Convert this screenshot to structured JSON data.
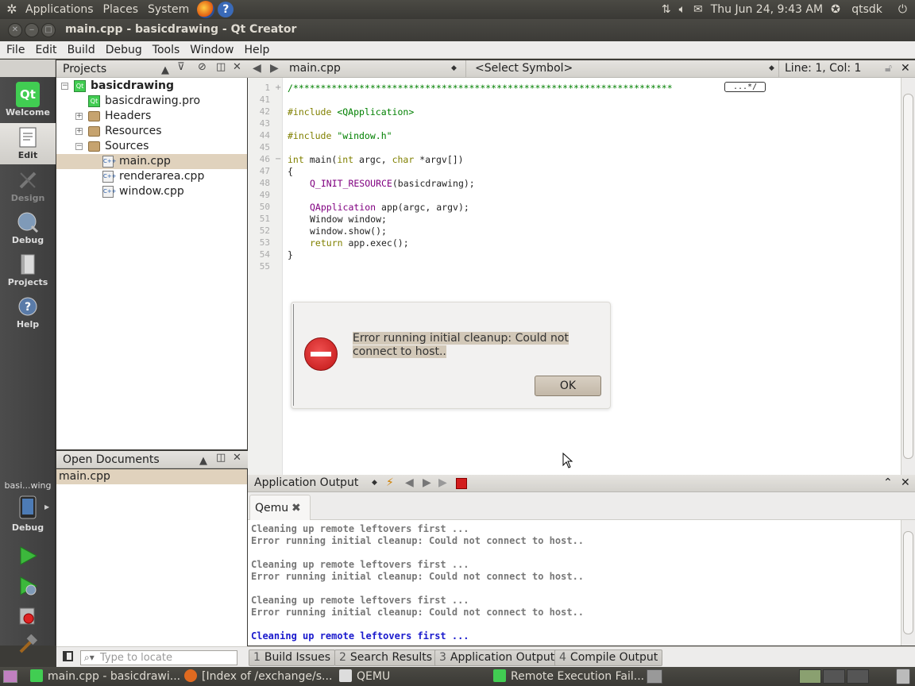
{
  "top_panel": {
    "menus": [
      "Applications",
      "Places",
      "System"
    ],
    "clock": "Thu Jun 24,  9:43 AM",
    "user": "qtsdk"
  },
  "window": {
    "title": "main.cpp - basicdrawing - Qt Creator"
  },
  "menubar": [
    "File",
    "Edit",
    "Build",
    "Debug",
    "Tools",
    "Window",
    "Help"
  ],
  "modes": [
    {
      "label": "Welcome",
      "icon": "qt-logo-icon"
    },
    {
      "label": "Edit",
      "icon": "edit-document-icon"
    },
    {
      "label": "Design",
      "icon": "design-pencil-icon"
    },
    {
      "label": "Debug",
      "icon": "debug-bug-icon"
    },
    {
      "label": "Projects",
      "icon": "projects-book-icon"
    },
    {
      "label": "Help",
      "icon": "help-icon"
    }
  ],
  "target": {
    "name": "basi...wing",
    "mode": "Debug"
  },
  "projects_pane": {
    "title": "Projects",
    "tree": [
      "basicdrawing",
      "basicdrawing.pro",
      "Headers",
      "Resources",
      "Sources",
      "main.cpp",
      "renderarea.cpp",
      "window.cpp"
    ]
  },
  "open_documents": {
    "title": "Open Documents",
    "items": [
      "main.cpp"
    ]
  },
  "editor": {
    "file_combo": "main.cpp",
    "symbol_combo": "<Select Symbol>",
    "position": "Line: 1, Col: 1",
    "line_numbers": [
      "1",
      "41",
      "42",
      "43",
      "44",
      "45",
      "46",
      "47",
      "48",
      "49",
      "50",
      "51",
      "52",
      "53",
      "54",
      "55"
    ],
    "header_comment": "/*********************************************************************",
    "fold_marker": "...*/",
    "code": {
      "inc1_kw": "#include ",
      "inc1_arg": "<QApplication>",
      "inc2_kw": "#include ",
      "inc2_arg": "\"window.h\"",
      "main_int": "int",
      "main_mid1": " main(",
      "main_int2": "int",
      "main_mid2": " argc, ",
      "main_char": "char",
      "main_end": " *argv[])",
      "open_brace": "{",
      "init_macro": "Q_INIT_RESOURCE",
      "init_rest": "(basicdrawing);",
      "app_type": "QApplication",
      "app_rest": " app(argc, argv);",
      "window_decl": "Window window;",
      "window_show": "window.show();",
      "ret_kw": "return",
      "ret_rest": " app.exec();",
      "close_brace": "}"
    }
  },
  "dialog": {
    "message": "Error running initial cleanup: Could not connect to host..",
    "ok_label": "OK"
  },
  "output_pane": {
    "title": "Application Output",
    "tab": "Qemu",
    "lines": [
      "Cleaning up remote leftovers first ...",
      "Error running initial cleanup: Could not connect to host..",
      "Cleaning up remote leftovers first ...",
      "Error running initial cleanup: Could not connect to host..",
      "Cleaning up remote leftovers first ...",
      "Error running initial cleanup: Could not connect to host..",
      "Cleaning up remote leftovers first ..."
    ]
  },
  "statusbar": {
    "locate_placeholder": "Type to locate",
    "buttons": [
      {
        "num": "1",
        "label": "Build Issues"
      },
      {
        "num": "2",
        "label": "Search Results"
      },
      {
        "num": "3",
        "label": "Application Output"
      },
      {
        "num": "4",
        "label": "Compile Output"
      }
    ]
  },
  "taskbar": [
    {
      "label": "main.cpp - basicdrawi..."
    },
    {
      "label": "[Index of /exchange/s..."
    },
    {
      "label": "QEMU"
    },
    {
      "label": "Remote Execution Fail..."
    }
  ]
}
